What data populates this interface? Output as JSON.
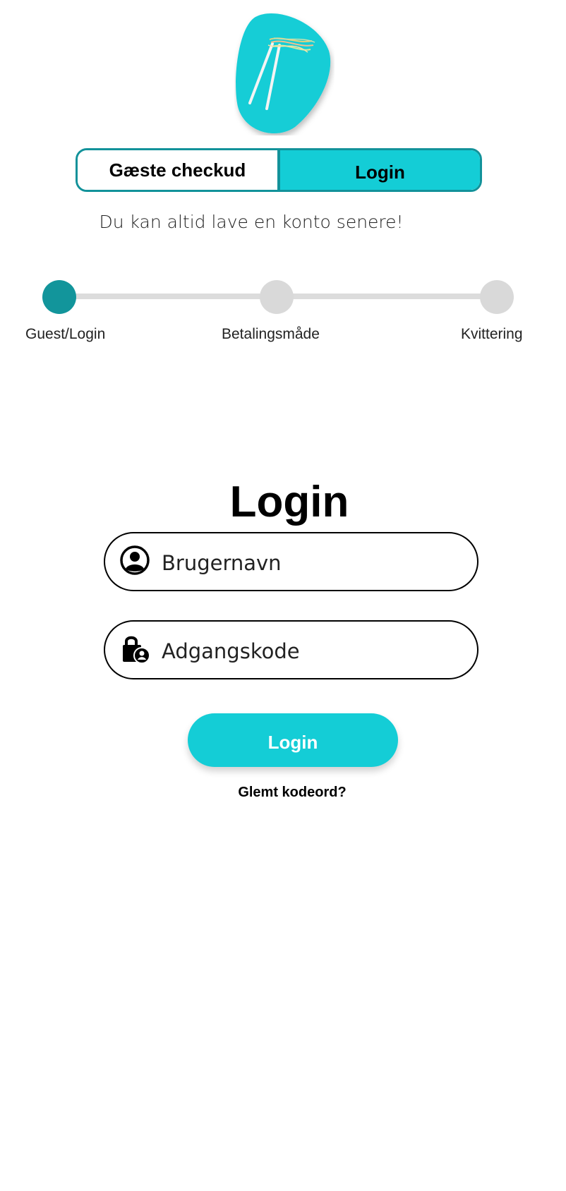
{
  "logo": {
    "icon": "chopsticks-noodles-logo",
    "color": "#14cdd6"
  },
  "tabs": {
    "guest_label": "Gæste checkud",
    "login_label": "Login",
    "active": "Login"
  },
  "subtitle": "Du kan altid lave en konto senere!",
  "stepper": {
    "steps": [
      {
        "label": "Guest/Login",
        "active": true
      },
      {
        "label": "Betalingsmåde",
        "active": false
      },
      {
        "label": "Kvittering",
        "active": false
      }
    ],
    "active_color": "#12959b",
    "inactive_color": "#d9d9d9"
  },
  "login_form": {
    "title": "Login",
    "username": {
      "placeholder": "Brugernavn",
      "value": "",
      "icon": "user-circle-icon"
    },
    "password": {
      "placeholder": "Adgangskode",
      "value": "",
      "icon": "lock-user-icon"
    },
    "submit_label": "Login",
    "forgot_label": "Glemt kodeord?"
  },
  "colors": {
    "accent": "#14cdd6",
    "accent_dark": "#12929a"
  }
}
